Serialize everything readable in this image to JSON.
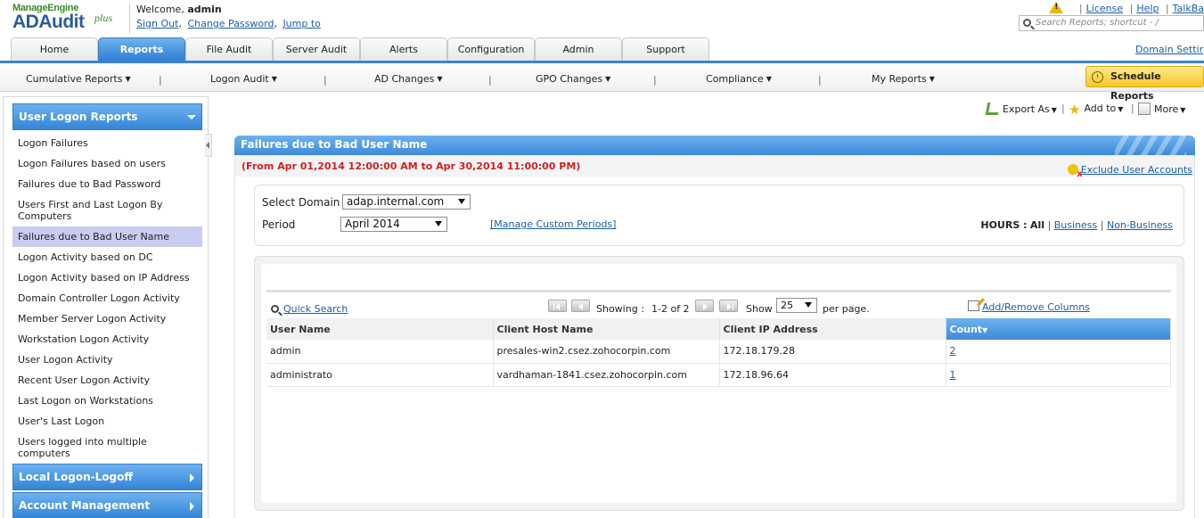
{
  "header": {
    "brand_top": "ManageEngine",
    "brand_product": "ADAudit",
    "brand_plus": "plus",
    "welcome_prefix": "Welcome,",
    "username": "admin",
    "links": [
      "Sign Out",
      "Change Password",
      "Jump to"
    ],
    "top_links": [
      "License",
      "Help",
      "TalkBa"
    ],
    "search_placeholder": "Search Reports; shortcut - /",
    "domain_settings": "Domain Settir"
  },
  "tabs": [
    {
      "label": "Home",
      "active": false
    },
    {
      "label": "Reports",
      "active": true
    },
    {
      "label": "File Audit",
      "active": false
    },
    {
      "label": "Server Audit",
      "active": false
    },
    {
      "label": "Alerts",
      "active": false
    },
    {
      "label": "Configuration",
      "active": false
    },
    {
      "label": "Admin",
      "active": false
    },
    {
      "label": "Support",
      "active": false
    }
  ],
  "menu": {
    "items": [
      "Cumulative Reports",
      "Logon Audit",
      "AD Changes",
      "GPO Changes",
      "Compliance",
      "My Reports"
    ],
    "schedule_button": "Schedule Reports"
  },
  "sidebar": {
    "section_open": "User Logon Reports",
    "items": [
      "Logon Failures",
      "Logon Failures based on users",
      "Failures due to Bad Password",
      "Users First and Last Logon By Computers",
      "Failures due to Bad User Name",
      "Logon Activity based on DC",
      "Logon Activity based on IP Address",
      "Domain Controller Logon Activity",
      "Member Server Logon Activity",
      "Workstation Logon Activity",
      "User Logon Activity",
      "Recent User Logon Activity",
      "Last Logon on Workstations",
      "User's Last Logon",
      "Users logged into multiple computers"
    ],
    "active_item": "Failures due to Bad User Name",
    "section_collapsed_1": "Local Logon-Logoff",
    "section_collapsed_2": "Account Management"
  },
  "actions": {
    "export": "Export As",
    "add_to": "Add to",
    "more": "More"
  },
  "report": {
    "title": "Failures due to Bad User Name",
    "range": "(From Apr 01,2014 12:00:00 AM to Apr 30,2014 11:00:00 PM)",
    "exclude_link": "Exclude User Accounts"
  },
  "filters": {
    "domain_label": "Select Domain",
    "domain_value": "adap.internal.com",
    "period_label": "Period",
    "period_value": "April 2014",
    "manage_periods": "[Manage Custom Periods]",
    "hours_label": "HOURS :",
    "hours_all": "All",
    "hours_business": "Business",
    "hours_nonbusiness": "Non-Business"
  },
  "toolbar": {
    "quick_search": "Quick Search",
    "showing_label": "Showing :",
    "showing_range": "1-2 of 2",
    "show_label": "Show",
    "per_page_value": "25",
    "per_page_label": "per page.",
    "add_remove_columns": "Add/Remove Columns"
  },
  "table": {
    "columns": [
      "User Name",
      "Client Host Name",
      "Client IP Address",
      "Count"
    ],
    "rows": [
      {
        "user": "admin",
        "host": "presales-win2.csez.zohocorpin.com",
        "ip": "172.18.179.28",
        "count": "2"
      },
      {
        "user": "administrato",
        "host": "vardhaman-1841.csez.zohocorpin.com",
        "ip": "172.18.96.64",
        "count": "1"
      }
    ]
  }
}
